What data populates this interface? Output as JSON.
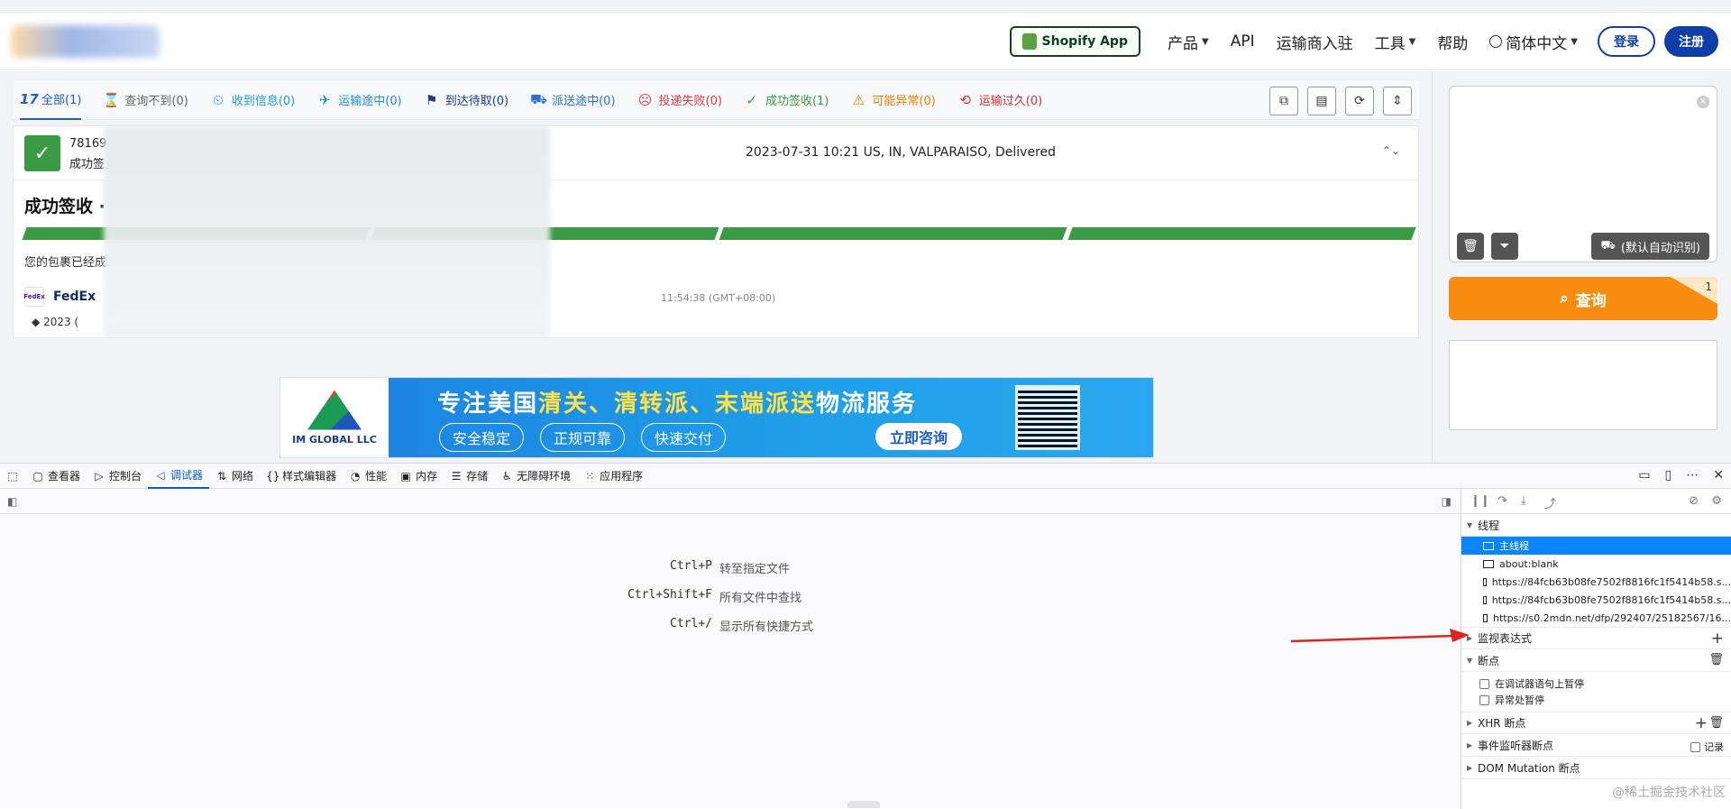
{
  "header": {
    "shopify_label": "Shopify App",
    "nav": [
      {
        "label": "产品",
        "caret": true
      },
      {
        "label": "API",
        "caret": false
      },
      {
        "label": "运输商入驻",
        "caret": false
      },
      {
        "label": "工具",
        "caret": true
      },
      {
        "label": "帮助",
        "caret": false
      }
    ],
    "language": "简体中文",
    "login": "登录",
    "signup": "注册"
  },
  "tabs": [
    {
      "label": "全部(1)",
      "icon": "17",
      "active": true,
      "color": "#1f5bd1"
    },
    {
      "label": "查询不到(0)",
      "icon": "⌛",
      "color": "#666666"
    },
    {
      "label": "收到信息(0)",
      "icon": "⏲",
      "color": "#1a9ed8"
    },
    {
      "label": "运输途中(0)",
      "icon": "✈",
      "color": "#1a8fdc"
    },
    {
      "label": "到达待取(0)",
      "icon": "⚑",
      "color": "#1a3b8a"
    },
    {
      "label": "派送途中(0)",
      "icon": "⛟",
      "color": "#2a6fd6"
    },
    {
      "label": "投递失败(0)",
      "icon": "☹",
      "color": "#e03a3a"
    },
    {
      "label": "成功签收(1)",
      "icon": "✓",
      "color": "#3a9b44"
    },
    {
      "label": "可能异常(0)",
      "icon": "⚠",
      "color": "#ef7d00"
    },
    {
      "label": "运输过久(0)",
      "icon": "⟲",
      "color": "#d23030"
    }
  ],
  "shipment": {
    "number": "78169",
    "status_short": "成功签",
    "event": "2023-07-31 10:21  US, IN, VALPARAISO, Delivered",
    "status_title": "成功签收 ·",
    "description": "您的包裹已经成",
    "carrier": "FedEx",
    "carrier_logo_text": "FedEx",
    "timestamp": "11:54:38 (GMT+08:00)",
    "year_row": "2023 ("
  },
  "ad": {
    "logo_text": "IM GLOBAL LLC",
    "headline_parts": [
      {
        "text": "专注美国",
        "y": false
      },
      {
        "text": "清关、清转派、末端派送",
        "y": true
      },
      {
        "text": "物流服务",
        "y": false
      }
    ],
    "pills": [
      "安全稳定",
      "正规可靠",
      "快速交付"
    ],
    "cta": "立即咨询"
  },
  "query": {
    "auto_label": "(默认自动识别)",
    "button": "查询",
    "badge": "1"
  },
  "devtools": {
    "tabs": [
      {
        "label": "查看器",
        "icon": "▢"
      },
      {
        "label": "控制台",
        "icon": "▷"
      },
      {
        "label": "调试器",
        "icon": "◁",
        "active": true
      },
      {
        "label": "网络",
        "icon": "⇅"
      },
      {
        "label": "样式编辑器",
        "icon": "{}"
      },
      {
        "label": "性能",
        "icon": "◔"
      },
      {
        "label": "内存",
        "icon": "▣"
      },
      {
        "label": "存储",
        "icon": "☰"
      },
      {
        "label": "无障碍环境",
        "icon": "♿"
      },
      {
        "label": "应用程序",
        "icon": "⁙"
      }
    ],
    "shortcuts": [
      {
        "key": "Ctrl+P",
        "desc": "转至指定文件"
      },
      {
        "key": "Ctrl+Shift+F",
        "desc": "所有文件中查找"
      },
      {
        "key": "Ctrl+/",
        "desc": "显示所有快捷方式"
      }
    ],
    "threads_title": "线程",
    "threads": [
      "主线程",
      "about:blank",
      "https://84fcb63b08fe7502f8816fc1f5414b58.s...",
      "https://84fcb63b08fe7502f8816fc1f5414b58.s...",
      "https://s0.2mdn.net/dfp/292407/25182567/16..."
    ],
    "watch_title": "监视表达式",
    "breakpoints_title": "断点",
    "bp_options": [
      "在调试器语句上暂停",
      "异常处暂停"
    ],
    "xhr_title": "XHR 断点",
    "event_title": "事件监听器断点",
    "record_label": "记录",
    "dom_title": "DOM Mutation 断点"
  },
  "watermark": "@稀土掘金技术社区"
}
